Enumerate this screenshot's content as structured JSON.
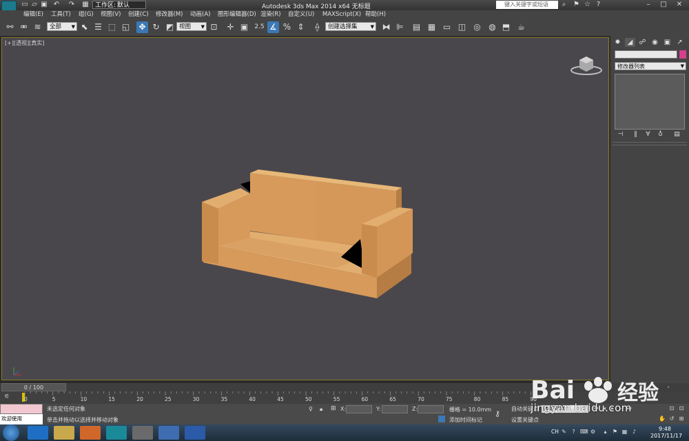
{
  "titlebar": {
    "workspace_label": "工作区:",
    "workspace_value": "默认",
    "app_title": "Autodesk 3ds Max  2014 x64     无标题",
    "search_placeholder": "键入关键字或短语"
  },
  "menu": [
    "编辑(E)",
    "工具(T)",
    "组(G)",
    "视图(V)",
    "创建(C)",
    "修改器(M)",
    "动画(A)",
    "图形编辑器(D)",
    "渲染(R)",
    "自定义(U)",
    "MAXScript(X)",
    "帮助(H)"
  ],
  "toolbar": {
    "filter_value": "全部",
    "ref_coord_value": "视图",
    "snap_value": "2.5",
    "named_sel_value": "创建选择集"
  },
  "viewport": {
    "label": "[+][透视][真实]"
  },
  "command_panel": {
    "modifier_list": "修改器列表"
  },
  "timeslider": {
    "frame_text": "0 / 100"
  },
  "trackbar": {
    "ticks": [
      "0",
      "5",
      "10",
      "15",
      "20",
      "25",
      "30",
      "35",
      "40",
      "45",
      "50",
      "55",
      "60",
      "65",
      "70",
      "75",
      "80",
      "85",
      "90"
    ]
  },
  "status": {
    "welcome": "欢迎使用 MAXScr",
    "line1": "未选定任何对象",
    "line2": "单击并拖动以选择并移动对象",
    "x_label": "X:",
    "y_label": "Y:",
    "z_label": "Z:",
    "grid": "栅格 = 10.0mm",
    "add_time_tag": "添加时间标记",
    "auto_key": "自动关键点",
    "set_key": "设置关键点",
    "selected_object": "选定对象"
  },
  "taskbar": {
    "lang": "CH",
    "time": "9:48",
    "date": "2017/11/17"
  },
  "watermark": {
    "brand": "Bai 经验",
    "url": "jingyan.baidu.com"
  },
  "colors": {
    "viewport_bg": "#4a474c",
    "sofa_front": "#d79a5a",
    "sofa_top": "#e2ae6f",
    "sofa_side": "#b57d43",
    "active_tool": "#3c78b4"
  }
}
